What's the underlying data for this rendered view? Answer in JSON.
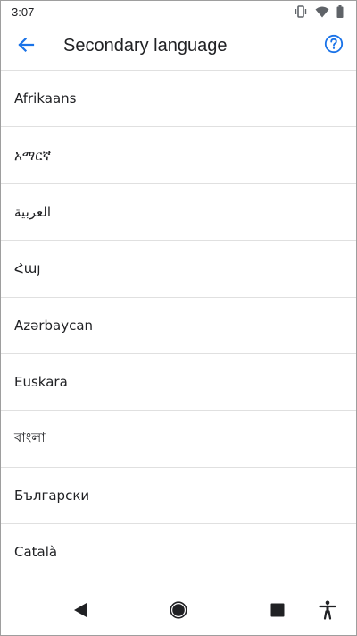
{
  "status_bar": {
    "time": "3:07",
    "icons": [
      "vibrate-icon",
      "wifi-icon",
      "battery-icon"
    ]
  },
  "app_bar": {
    "title": "Secondary language",
    "back_icon": "arrow-back-icon",
    "help_icon": "help-circle-icon",
    "accent_color": "#1a73e8"
  },
  "languages": [
    {
      "label": "Afrikaans"
    },
    {
      "label": "አማርኛ"
    },
    {
      "label": "العربية"
    },
    {
      "label": "Հայ"
    },
    {
      "label": "Azərbaycan"
    },
    {
      "label": "Euskara"
    },
    {
      "label": "বাংলা"
    },
    {
      "label": "Български"
    },
    {
      "label": "Català"
    }
  ],
  "nav_bar": {
    "icons": [
      "back-triangle-icon",
      "home-circle-icon",
      "recents-square-icon",
      "accessibility-icon"
    ]
  }
}
